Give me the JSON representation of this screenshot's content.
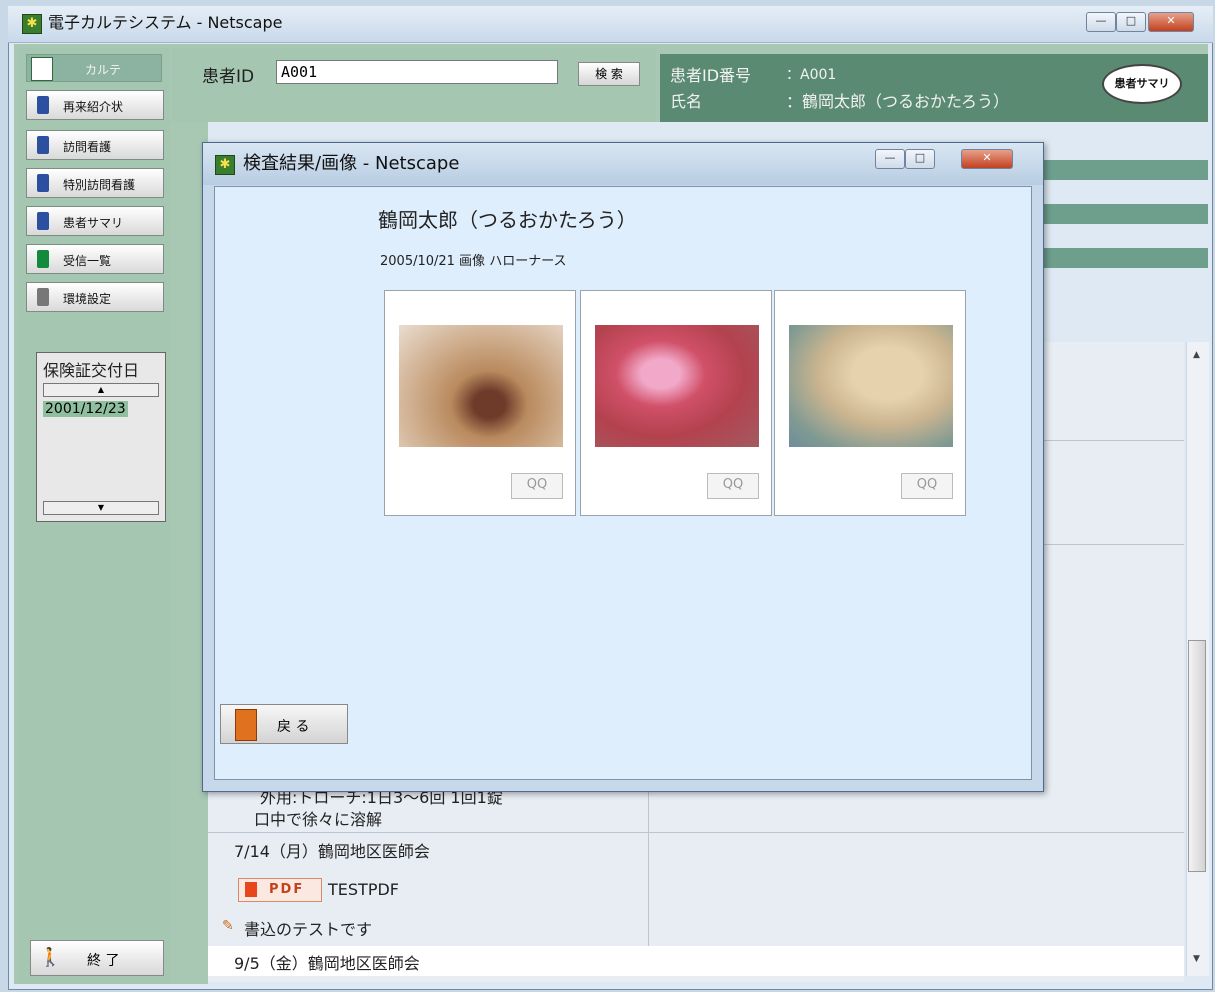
{
  "main_window": {
    "title": "電子カルテシステム - Netscape"
  },
  "sidebar": {
    "karte_tab": "カルテ",
    "items": [
      {
        "label": "再来紹介状"
      },
      {
        "label": "訪問看護"
      },
      {
        "label": "特別訪問看護"
      },
      {
        "label": "患者サマリ"
      },
      {
        "label": "受信一覧"
      },
      {
        "label": "環境設定"
      }
    ],
    "insurance": {
      "title": "保険証交付日",
      "value": "2001/12/23"
    },
    "end_button": "終 了"
  },
  "search": {
    "label": "患者ID",
    "value": "A001",
    "button": "検 索"
  },
  "patient_panel": {
    "id_label": "患者ID番号",
    "id_value": "：A001",
    "name_label": "氏名",
    "name_value": "：鶴岡太郎（つるおかたろう）",
    "summary_button": "患者サマリ"
  },
  "rows": [
    {
      "text": "外用:トローチ:1日3〜6回 1回1錠"
    },
    {
      "text": "口中で徐々に溶解"
    },
    {
      "text": "7/14（月）鶴岡地区医師会"
    },
    {
      "pdf_badge": "PDF",
      "pdf_name": "TESTPDF"
    },
    {
      "text": "書込のテストです"
    },
    {
      "text": "9/5（金）鶴岡地区医師会"
    }
  ],
  "popup": {
    "title": "検査結果/画像 - Netscape",
    "patient_name": "鶴岡太郎（つるおかたろう）",
    "subtitle": "2005/10/21 画像 ハローナース",
    "back_button": "戻 る",
    "zoom_symbol": "QQ"
  },
  "colors": {
    "panel_green": "#5b8a73",
    "side_green": "#a5c6b1",
    "stripe_teal": "#6e9f8d"
  }
}
